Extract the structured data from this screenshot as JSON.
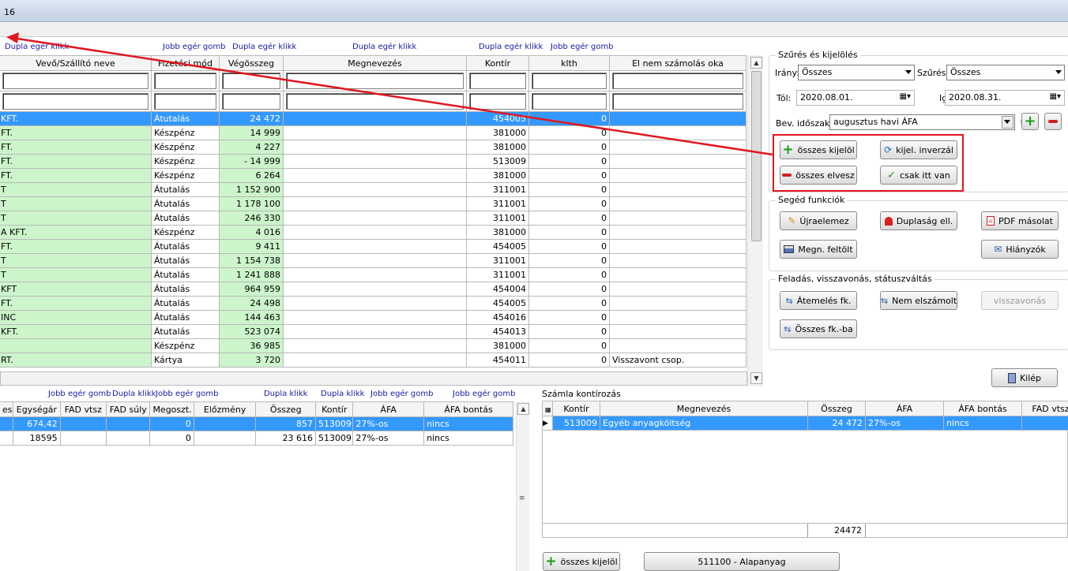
{
  "app": {
    "title": "16"
  },
  "top_hints": [
    "Dupla egér klikk",
    "Jobb egér gomb",
    "Dupla egér klikk",
    "Dupla egér klikk",
    "Dupla egér klikk",
    "Jobb egér gomb"
  ],
  "main_table": {
    "headers": [
      "Vevő/Szállító neve",
      "Fizetési mód",
      "Végösszeg",
      "Megnevezés",
      "Kontír",
      "klth",
      "El nem számolás oka"
    ],
    "rows": [
      [
        "KFT.",
        "Átutalás",
        "24 472",
        "",
        "454005",
        "0",
        ""
      ],
      [
        "FT.",
        "Készpénz",
        "14 999",
        "",
        "381000",
        "0",
        ""
      ],
      [
        "FT.",
        "Készpénz",
        "4 227",
        "",
        "381000",
        "0",
        ""
      ],
      [
        "FT.",
        "Készpénz",
        "- 14 999",
        "",
        "513009",
        "0",
        ""
      ],
      [
        "FT.",
        "Készpénz",
        "6 264",
        "",
        "381000",
        "0",
        ""
      ],
      [
        "T",
        "Átutalás",
        "1 152 900",
        "",
        "311001",
        "0",
        ""
      ],
      [
        "T",
        "Átutalás",
        "1 178 100",
        "",
        "311001",
        "0",
        ""
      ],
      [
        "T",
        "Átutalás",
        "246 330",
        "",
        "311001",
        "0",
        ""
      ],
      [
        "A KFT.",
        "Készpénz",
        "4 016",
        "",
        "381000",
        "0",
        ""
      ],
      [
        "FT.",
        "Átutalás",
        "9 411",
        "",
        "454005",
        "0",
        ""
      ],
      [
        "T",
        "Átutalás",
        "1 154 738",
        "",
        "311001",
        "0",
        ""
      ],
      [
        "T",
        "Átutalás",
        "1 241 888",
        "",
        "311001",
        "0",
        ""
      ],
      [
        "KFT",
        "Átutalás",
        "964 959",
        "",
        "454004",
        "0",
        ""
      ],
      [
        "FT.",
        "Átutalás",
        "24 498",
        "",
        "454005",
        "0",
        ""
      ],
      [
        "INC",
        "Átutalás",
        "144 463",
        "",
        "454016",
        "0",
        ""
      ],
      [
        "KFT.",
        "Átutalás",
        "523 074",
        "",
        "454013",
        "0",
        ""
      ],
      [
        "",
        "Készpénz",
        "36 985",
        "",
        "381000",
        "0",
        ""
      ],
      [
        "RT.",
        "Kártya",
        "3 720",
        "",
        "454011",
        "0",
        "Visszavont csop."
      ]
    ]
  },
  "filter_panel": {
    "title": "Szűrés és kijelölés",
    "irany_label": "Irány:",
    "irany_value": "Összes",
    "szures_label": "Szűrés:",
    "szures_value": "Összes",
    "tol_label": "Tól:",
    "tol_value": "2020.08.01.",
    "ig_label": "Ig:",
    "ig_value": "2020.08.31.",
    "bev_label": "Bev. időszak:",
    "bev_value": "augusztus havi ÁFA",
    "btn_select_all": "összes kijelöl",
    "btn_invert": "kijel. inverzál",
    "btn_deselect_all": "összes elvesz",
    "btn_only_here": "csak itt van"
  },
  "helper_panel": {
    "title": "Segéd funkciók",
    "btn_recalc": "Újraelemez",
    "btn_dup": "Duplaság ell.",
    "btn_pdf": "PDF másolat",
    "btn_desc": "Megn. feltölt",
    "btn_missing": "Hiányzók"
  },
  "post_panel": {
    "title": "Feladás, visszavonás, státuszváltás",
    "btn_transfer": "Átemelés fk.",
    "btn_not_settled": "Nem elszámolt",
    "btn_revoke": "visszavonás",
    "btn_all_fk": "Összes fk.-ba"
  },
  "exit_button": "Kilép",
  "bottom_hints": [
    "Jobb egér gomb",
    "Dupla klikk",
    "Jobb egér gomb",
    "Dupla klikk",
    "Dupla klikk",
    "Jobb egér gomb",
    "Jobb egér gomb"
  ],
  "items_table": {
    "headers": [
      "Egységár",
      "FAD vtsz",
      "FAD súly",
      "Megoszt.",
      "Előzmény",
      "Összeg",
      "Kontír",
      "ÁFA",
      "ÁFA bontás"
    ],
    "rows": [
      [
        "674,42",
        "",
        "",
        "0",
        "",
        "857",
        "513009",
        "27%-os",
        "nincs"
      ],
      [
        "18595",
        "",
        "",
        "0",
        "",
        "23 616",
        "513009",
        "27%-os",
        "nincs"
      ]
    ],
    "first_col_fragment": "es."
  },
  "kontir_panel": {
    "title": "Számla kontírozás",
    "headers": [
      "Kontír",
      "Megnevezés",
      "Összeg",
      "ÁFA",
      "ÁFA bontás",
      "FAD vtsz"
    ],
    "rows": [
      [
        "513009",
        "Egyéb anyagköltség",
        "24 472",
        "27%-os",
        "nincs",
        ""
      ]
    ],
    "total": "24472",
    "btn_select_all": "összes kijelöl",
    "btn_account": "511100 - Alapanyag"
  },
  "colors": {
    "selection": "#3399ff",
    "green": "#ccf5cc",
    "annotation": "#e0161e",
    "hint": "#1a1aa6"
  }
}
